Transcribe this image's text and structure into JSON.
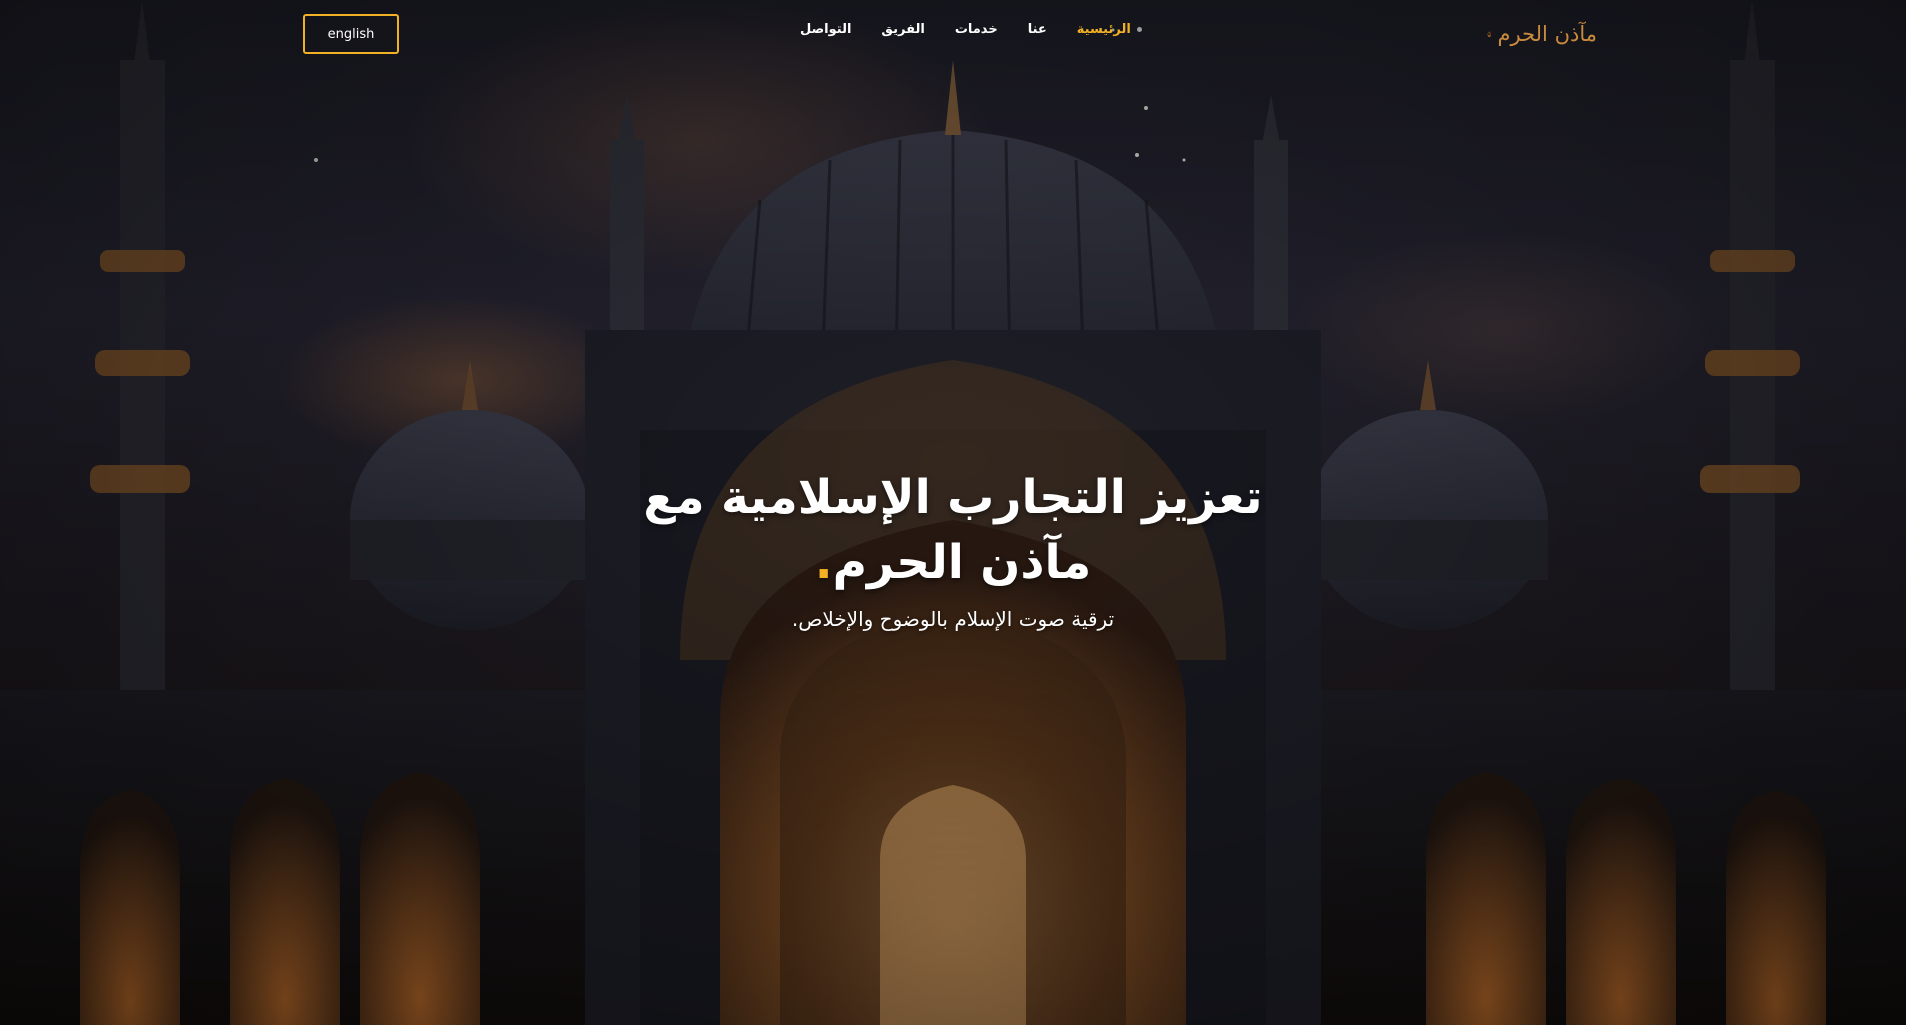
{
  "header": {
    "language_button": "english",
    "nav": [
      {
        "label": "الرئيسية",
        "active": true
      },
      {
        "label": "عنا",
        "active": false
      },
      {
        "label": "خدمات",
        "active": false
      },
      {
        "label": "الفريق",
        "active": false
      },
      {
        "label": "التواصل",
        "active": false
      }
    ],
    "logo_text": "مآذن الحرم"
  },
  "hero": {
    "title_line1": "تعزيز التجارب الإسلامية مع",
    "title_line2": "مآذن الحرم",
    "title_accent": ".",
    "subtitle": "ترقية صوت الإسلام بالوضوح والإخلاص."
  },
  "colors": {
    "accent": "#f2b024",
    "text": "#ffffff",
    "background": "#1c1c26"
  },
  "icons": {
    "nav_bullet": "dot-icon",
    "logo": "logo-emblem-icon"
  }
}
